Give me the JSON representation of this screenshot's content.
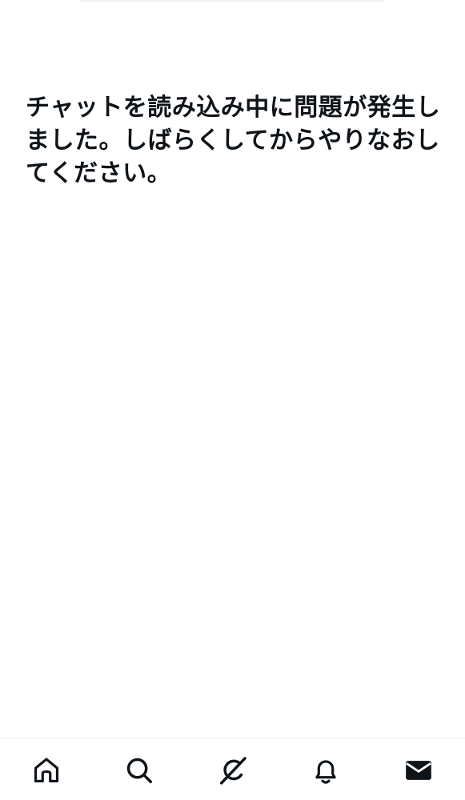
{
  "error": {
    "message": "チャットを読み込み中に問題が発生しました。しばらくしてからやりなおしてください。"
  },
  "bottom_nav": {
    "items": [
      {
        "icon": "home-icon",
        "active": false
      },
      {
        "icon": "search-icon",
        "active": false
      },
      {
        "icon": "grok-icon",
        "active": false
      },
      {
        "icon": "bell-icon",
        "active": false
      },
      {
        "icon": "mail-icon",
        "active": true
      }
    ]
  },
  "colors": {
    "text": "#0f1419",
    "background": "#ffffff",
    "divider": "#eff3f4"
  }
}
